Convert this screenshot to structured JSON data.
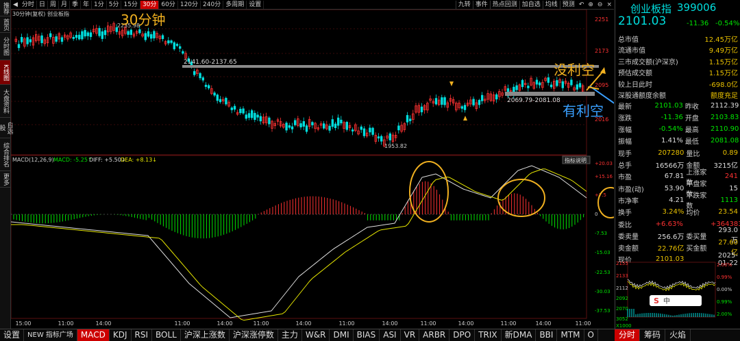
{
  "toolbar": {
    "periods": [
      "分时",
      "日",
      "周",
      "月",
      "季",
      "年",
      "1分",
      "5分",
      "15分",
      "30分",
      "60分",
      "120分",
      "240分",
      "多周期",
      "设置"
    ],
    "active_period": "30分",
    "right_buttons": [
      "九转",
      "事件",
      "热点回测",
      "加自选",
      "均线",
      "预测"
    ]
  },
  "leftnav": {
    "items": [
      "推荐",
      "首页",
      "分时图",
      "K线图",
      "大盘资料",
      "自选股",
      "综合排名",
      "更多"
    ],
    "active": "K线图"
  },
  "chart": {
    "title": "30分钟(复权)  创业板指",
    "annotation_period": "30分钟",
    "high_label": "2251",
    "price_labels": [
      "2251",
      "2173",
      "2095",
      "2016"
    ],
    "point_labels": {
      "peak": "2235.98",
      "low": "1953.82"
    },
    "zone_upper_label": "2141.60-2137.65",
    "zone_lower_label": "2069.79-2081.08",
    "annot_no_short": "没利空",
    "annot_short": "有利空",
    "macd_title": "MACD(12,26,9)",
    "macd_label": "MACD: -5.25↑",
    "diff_label": "DIFF: +5.50↓",
    "dea_label": "DEA: +8.13↓",
    "indicator_help": "指标说明",
    "macd_axis": [
      "+20.03",
      "+15.16",
      "+7.5",
      "0",
      "-7.53",
      "-15.03",
      "-22.53",
      "-30.03",
      "-37.53"
    ],
    "time_axis": [
      "15:00",
      "11:00",
      "14:00",
      "11:00",
      "14:00",
      "11:00",
      "14:00",
      "11:00",
      "14:00",
      "11:00",
      "14:00",
      "11:00",
      "14:00",
      "11:00",
      "14:00"
    ]
  },
  "right": {
    "name": "创业板指",
    "code": "399006",
    "price": "2101.03",
    "change": "-11.36",
    "pct": "-0.54%",
    "stats": [
      {
        "label": "总市值",
        "value": "12.45万亿"
      },
      {
        "label": "流通市值",
        "value": "9.49万亿"
      },
      {
        "label": "三市成交额(沪深京)",
        "value": "1.15万亿"
      },
      {
        "label": "预估成交额",
        "value": "1.15万亿"
      },
      {
        "label": "较上日此时",
        "value": "-698.0亿"
      },
      {
        "label": "深股通额度余额",
        "value": "额度充足"
      }
    ],
    "quotes": [
      {
        "l1": "最新",
        "v1": "2101.03",
        "l2": "昨收",
        "v2": "2112.39",
        "c1": "green",
        "c2": "white"
      },
      {
        "l1": "涨跌",
        "v1": "-11.36",
        "l2": "开盘",
        "v2": "2103.83",
        "c1": "green",
        "c2": "green"
      },
      {
        "l1": "涨幅",
        "v1": "-0.54%",
        "l2": "最高",
        "v2": "2110.90",
        "c1": "green",
        "c2": "green"
      },
      {
        "l1": "振幅",
        "v1": "1.41%",
        "l2": "最低",
        "v2": "2081.08",
        "c1": "white",
        "c2": "green"
      },
      {
        "l1": "现手",
        "v1": "207280",
        "l2": "量比",
        "v2": "0.89",
        "c1": "yellow",
        "c2": "yellow"
      },
      {
        "l1": "总手",
        "v1": "16566万",
        "l2": "金额",
        "v2": "3215亿",
        "c1": "white",
        "c2": "white"
      },
      {
        "l1": "市盈",
        "v1": "67.81",
        "l2": "上涨家数",
        "v2": "241",
        "c1": "white",
        "c2": "red"
      },
      {
        "l1": "市盈(动)",
        "v1": "53.90",
        "l2": "平盘家数",
        "v2": "15",
        "c1": "white",
        "c2": "white"
      },
      {
        "l1": "市净率",
        "v1": "4.21",
        "l2": "下跌家数",
        "v2": "1113",
        "c1": "white",
        "c2": "green"
      },
      {
        "l1": "换手",
        "v1": "3.24%",
        "l2": "均价",
        "v2": "23.54",
        "c1": "yellow",
        "c2": "yellow"
      },
      {
        "l1": "委比",
        "v1": "+6.63%",
        "l2": "",
        "v2": "+364383",
        "c1": "red",
        "c2": "red"
      },
      {
        "l1": "委卖量",
        "v1": "256.6万",
        "l2": "委买量",
        "v2": "293.0万",
        "c1": "white",
        "c2": "white"
      },
      {
        "l1": "卖金额",
        "v1": "22.76亿",
        "l2": "买金额",
        "v2": "27.60亿",
        "c1": "yellow",
        "c2": "yellow"
      },
      {
        "l1": "现价",
        "v1": "2101.03",
        "l2": "",
        "v2": "2025-01-22",
        "c1": "yellow",
        "c2": "white"
      }
    ],
    "mini_chart": {
      "left_axis": [
        "2155",
        "2133",
        "2112",
        "2092",
        "2070",
        "3052",
        "X1000"
      ],
      "right_axis": [
        "2.00%",
        "0.99%",
        "0.00%",
        "0.99%",
        "2.00%"
      ]
    },
    "tray": {
      "sogou": "S",
      "lang": "中"
    }
  },
  "bottom": {
    "tabs": [
      "设置",
      "NEW 指标广场",
      "MACD",
      "KDJ",
      "RSI",
      "BOLL",
      "沪深上涨数",
      "沪深涨停数",
      "主力",
      "W&R",
      "DMI",
      "BIAS",
      "ASI",
      "VR",
      "ARBR",
      "DPO",
      "TRIX",
      "新DMA",
      "BBI",
      "MTM",
      "O"
    ],
    "active": "MACD",
    "right_tabs": [
      "分时",
      "筹码",
      "火焰"
    ],
    "right_active": "分时"
  },
  "colors": {
    "up": "#ff3232",
    "down": "#00dede",
    "annot": "#f0b020",
    "accent": "#c00000"
  }
}
